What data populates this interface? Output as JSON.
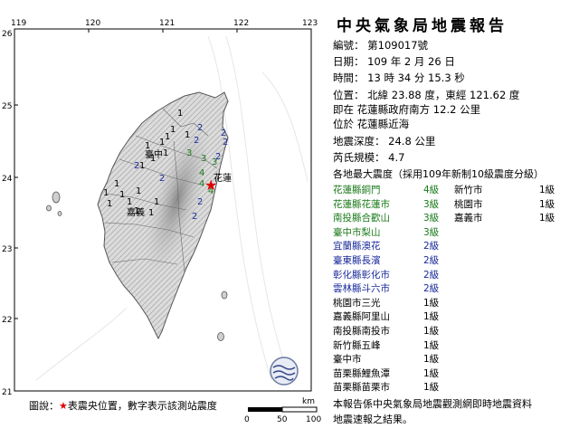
{
  "report": {
    "title": "中央氣象局地震報告",
    "number": "編號： 第109017號",
    "date": "日期： 109 年 2 月 26 日",
    "time": "時間： 13 時 34 分 15.3 秒",
    "position": "位置： 北緯 23.88 度，東經 121.62 度",
    "relative": "即在 花蓮縣政府南方 12.2 公里",
    "located": "位於 花蓮縣近海",
    "depth": "地震深度： 24.8 公里",
    "magnitude": "芮氏規模： 4.7",
    "max_intensity_header": "各地最大震度（採用109年新制10級震度分級）",
    "footer1": "本報告係中央氣象局地震觀測網即時地震資料",
    "footer2": "地震速報之結果。"
  },
  "stations_left": [
    {
      "name": "花蓮縣銅門",
      "intensity": "4級",
      "color": "green"
    },
    {
      "name": "花蓮縣花蓮市",
      "intensity": "3級",
      "color": "green"
    },
    {
      "name": "南投縣合歡山",
      "intensity": "3級",
      "color": "green"
    },
    {
      "name": "臺中市梨山",
      "intensity": "3級",
      "color": "green"
    },
    {
      "name": "宜蘭縣澳花",
      "intensity": "2級",
      "color": "blue"
    },
    {
      "name": "臺東縣長濱",
      "intensity": "2級",
      "color": "blue"
    },
    {
      "name": "彰化縣彰化市",
      "intensity": "2級",
      "color": "blue"
    },
    {
      "name": "雲林縣斗六市",
      "intensity": "2級",
      "color": "blue"
    },
    {
      "name": "桃園市三光",
      "intensity": "1級",
      "color": "black"
    },
    {
      "name": "嘉義縣阿里山",
      "intensity": "1級",
      "color": "black"
    },
    {
      "name": "南投縣南投市",
      "intensity": "1級",
      "color": "black"
    },
    {
      "name": "新竹縣五峰",
      "intensity": "1級",
      "color": "black"
    },
    {
      "name": "臺中市",
      "intensity": "1級",
      "color": "black"
    },
    {
      "name": "苗栗縣鯉魚潭",
      "intensity": "1級",
      "color": "black"
    },
    {
      "name": "苗栗縣苗栗市",
      "intensity": "1級",
      "color": "black"
    }
  ],
  "stations_right": [
    {
      "name": "新竹市",
      "intensity": "1級",
      "color": "black"
    },
    {
      "name": "桃園市",
      "intensity": "1級",
      "color": "black"
    },
    {
      "name": "嘉義市",
      "intensity": "1級",
      "color": "black"
    }
  ],
  "map": {
    "lon_ticks": [
      "119",
      "120",
      "121",
      "122",
      "123"
    ],
    "lat_ticks": [
      "26",
      "25",
      "24",
      "23",
      "22",
      "21"
    ],
    "scale_unit": "km",
    "scale_ticks": [
      "0",
      "50",
      "100"
    ],
    "legend_prefix": "圖說：",
    "legend_star": "★",
    "legend_text": "表震央位置，數字表示該測站震度",
    "epicenter_label": "花蓮",
    "place_labels": [
      "臺中",
      "嘉義"
    ],
    "intensity_marks": [
      {
        "v": "1",
        "c": "black"
      },
      {
        "v": "1",
        "c": "black"
      },
      {
        "v": "1",
        "c": "black"
      },
      {
        "v": "1",
        "c": "black"
      },
      {
        "v": "1",
        "c": "black"
      },
      {
        "v": "1",
        "c": "black"
      },
      {
        "v": "1",
        "c": "black"
      },
      {
        "v": "1",
        "c": "black"
      },
      {
        "v": "1",
        "c": "black"
      },
      {
        "v": "1",
        "c": "black"
      },
      {
        "v": "1",
        "c": "black"
      },
      {
        "v": "1",
        "c": "black"
      },
      {
        "v": "1",
        "c": "black"
      },
      {
        "v": "1",
        "c": "black"
      },
      {
        "v": "1",
        "c": "black"
      },
      {
        "v": "1",
        "c": "black"
      },
      {
        "v": "1",
        "c": "black"
      },
      {
        "v": "1",
        "c": "black"
      },
      {
        "v": "2",
        "c": "blue"
      },
      {
        "v": "2",
        "c": "blue"
      },
      {
        "v": "2",
        "c": "blue"
      },
      {
        "v": "2",
        "c": "blue"
      },
      {
        "v": "2",
        "c": "blue"
      },
      {
        "v": "2",
        "c": "blue"
      },
      {
        "v": "2",
        "c": "blue"
      },
      {
        "v": "2",
        "c": "blue"
      },
      {
        "v": "2",
        "c": "blue"
      },
      {
        "v": "3",
        "c": "green"
      },
      {
        "v": "3",
        "c": "green"
      },
      {
        "v": "3",
        "c": "green"
      },
      {
        "v": "4",
        "c": "green"
      },
      {
        "v": "4",
        "c": "green"
      },
      {
        "v": "4",
        "c": "green"
      }
    ],
    "colors": {
      "sea": "#ffffff",
      "land": "#d8d8d8",
      "relief": "#9a9a9a",
      "star": "#e00000",
      "green": "#1a7a1a",
      "blue": "#1a2a9a"
    }
  }
}
